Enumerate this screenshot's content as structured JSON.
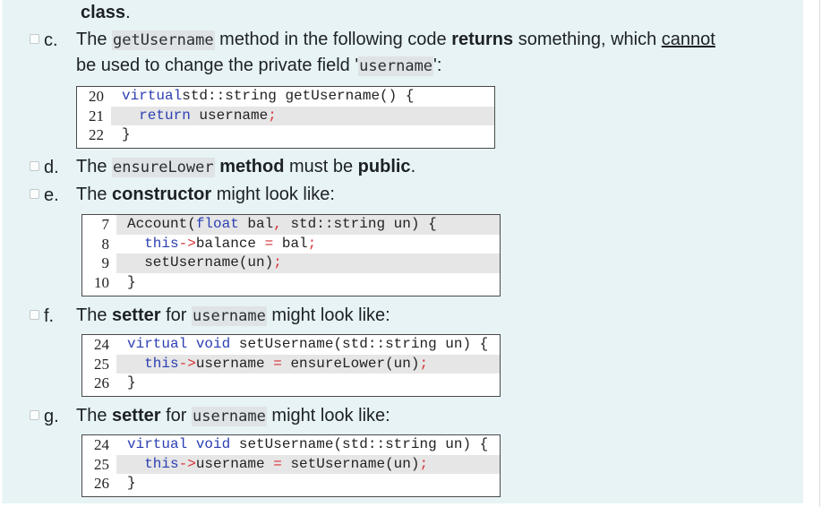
{
  "top_fragment": {
    "bold": "class",
    "rest": "."
  },
  "options": [
    {
      "letter": "c.",
      "line1": {
        "t1": "The ",
        "code1": "getUsername",
        "t2": " method in the following code ",
        "bold1": "returns",
        "t3": " something, which ",
        "underline1": "cannot"
      },
      "line2": {
        "t1": "be used to change the private field '",
        "code1": "username",
        "t2": "':"
      },
      "code": [
        {
          "n": "20",
          "hl": false,
          "tokens": [
            [
              "kw",
              "virtual"
            ],
            [
              "",
              "std::string getUsername() {"
            ]
          ]
        },
        {
          "n": "21",
          "hl": true,
          "tokens": [
            [
              "",
              "  "
            ],
            [
              "kw",
              "return"
            ],
            [
              "",
              " username"
            ],
            [
              "op",
              ";"
            ]
          ]
        },
        {
          "n": "22",
          "hl": false,
          "tokens": [
            [
              "",
              "}"
            ]
          ]
        }
      ]
    },
    {
      "letter": "d.",
      "line1": {
        "t1": "The ",
        "code1": "ensureLower",
        "t2": " ",
        "bold1": "method",
        "t3": " must be ",
        "bold2": "public",
        "t4": "."
      }
    },
    {
      "letter": "e.",
      "line1": {
        "t1": "The ",
        "bold1": "constructor",
        "t2": " might look like:"
      },
      "code": [
        {
          "n": "7",
          "hl": true,
          "tokens": [
            [
              "",
              "Account("
            ],
            [
              "kw",
              "float"
            ],
            [
              "",
              " bal"
            ],
            [
              "op",
              ","
            ],
            [
              "",
              " std::string un) {"
            ]
          ]
        },
        {
          "n": "8",
          "hl": false,
          "tokens": [
            [
              "",
              "  "
            ],
            [
              "kw",
              "this"
            ],
            [
              "op",
              "->"
            ],
            [
              "",
              "balance "
            ],
            [
              "op",
              "="
            ],
            [
              "",
              " bal"
            ],
            [
              "op",
              ";"
            ]
          ]
        },
        {
          "n": "9",
          "hl": true,
          "tokens": [
            [
              "",
              "  setUsername(un)"
            ],
            [
              "op",
              ";"
            ]
          ]
        },
        {
          "n": "10",
          "hl": false,
          "tokens": [
            [
              "",
              "}"
            ]
          ]
        }
      ]
    },
    {
      "letter": "f.",
      "line1": {
        "t1": "The ",
        "bold1": "setter",
        "t2": " for ",
        "code1": "username",
        "t3": " might look like:"
      },
      "code": [
        {
          "n": "24",
          "hl": false,
          "tokens": [
            [
              "kw",
              "virtual"
            ],
            [
              "",
              " "
            ],
            [
              "kw",
              "void"
            ],
            [
              "",
              " setUsername(std::string un) {"
            ]
          ]
        },
        {
          "n": "25",
          "hl": true,
          "tokens": [
            [
              "",
              "  "
            ],
            [
              "kw",
              "this"
            ],
            [
              "op",
              "->"
            ],
            [
              "",
              "username "
            ],
            [
              "op",
              "="
            ],
            [
              "",
              " ensureLower(un)"
            ],
            [
              "op",
              ";"
            ]
          ]
        },
        {
          "n": "26",
          "hl": false,
          "tokens": [
            [
              "",
              "}"
            ]
          ]
        }
      ]
    },
    {
      "letter": "g.",
      "line1": {
        "t1": "The ",
        "bold1": "setter",
        "t2": " for ",
        "code1": "username",
        "t3": " might look like:"
      },
      "code": [
        {
          "n": "24",
          "hl": false,
          "tokens": [
            [
              "kw",
              "virtual"
            ],
            [
              "",
              " "
            ],
            [
              "kw",
              "void"
            ],
            [
              "",
              " setUsername(std::string un) {"
            ]
          ]
        },
        {
          "n": "25",
          "hl": true,
          "tokens": [
            [
              "",
              "  "
            ],
            [
              "kw",
              "this"
            ],
            [
              "op",
              "->"
            ],
            [
              "",
              "username "
            ],
            [
              "op",
              "="
            ],
            [
              "",
              " setUsername(un)"
            ],
            [
              "op",
              ";"
            ]
          ]
        },
        {
          "n": "26",
          "hl": false,
          "tokens": [
            [
              "",
              "}"
            ]
          ]
        }
      ]
    }
  ],
  "colors": {
    "panel_bg": "#e7f3f5",
    "keyword": "#2b3fb2",
    "operator": "#d6333a",
    "line_highlight": "#e6e6e6",
    "inline_code_bg": "#dfe3e5"
  }
}
